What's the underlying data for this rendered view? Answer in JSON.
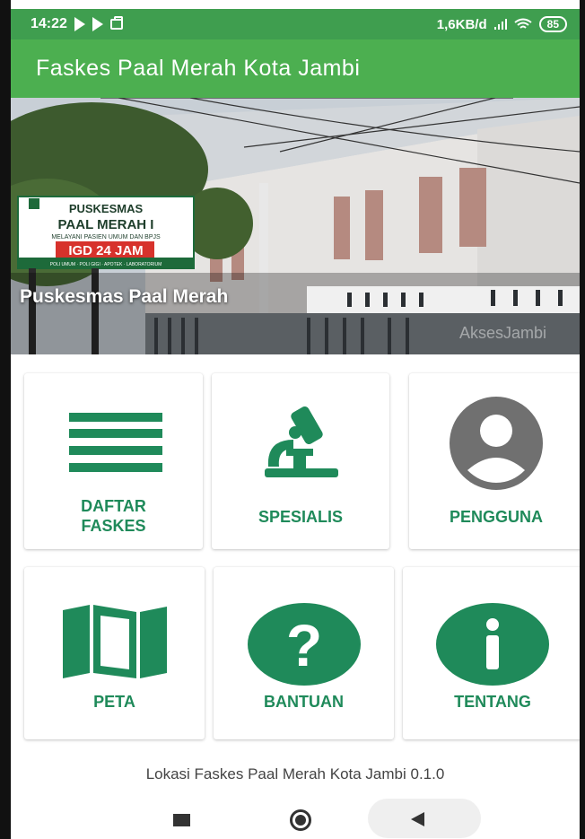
{
  "status_bar": {
    "time": "14:22",
    "speed": "1,6KB/d",
    "battery": "85",
    "icons": [
      "play-store-icon",
      "play-store-icon",
      "briefcase-icon",
      "signal-icon",
      "wifi-icon",
      "battery-icon"
    ]
  },
  "app_bar": {
    "title": "Faskes Paal Merah Kota Jambi"
  },
  "hero": {
    "caption": "Puskesmas Paal Merah",
    "sign_line1": "PUSKESMAS",
    "sign_line2": "PAAL MERAH I",
    "sign_line3": "MELAYANI PASIEN UMUM DAN BPJS",
    "sign_line4": "IGD 24 JAM",
    "sign_line5": "POLI UMUM · POLI GIGI · APOTEK · LABORATORIUM",
    "watermark": "AksesJambi"
  },
  "menu": [
    {
      "label_line1": "DAFTAR",
      "label_line2": "FASKES",
      "icon": "list-icon"
    },
    {
      "label_line1": "SPESIALIS",
      "label_line2": "",
      "icon": "microscope-icon"
    },
    {
      "label_line1": "PENGGUNA",
      "label_line2": "",
      "icon": "user-icon"
    },
    {
      "label_line1": "PETA",
      "label_line2": "",
      "icon": "map-icon"
    },
    {
      "label_line1": "BANTUAN",
      "label_line2": "",
      "icon": "help-icon"
    },
    {
      "label_line1": "TENTANG",
      "label_line2": "",
      "icon": "info-icon"
    }
  ],
  "footer": {
    "text": "Lokasi Faskes Paal Merah Kota Jambi 0.1.0"
  },
  "colors": {
    "status_bar": "#3f9e4f",
    "app_bar": "#4caf50",
    "accent": "#1f8a5a",
    "user_icon": "#707070"
  }
}
